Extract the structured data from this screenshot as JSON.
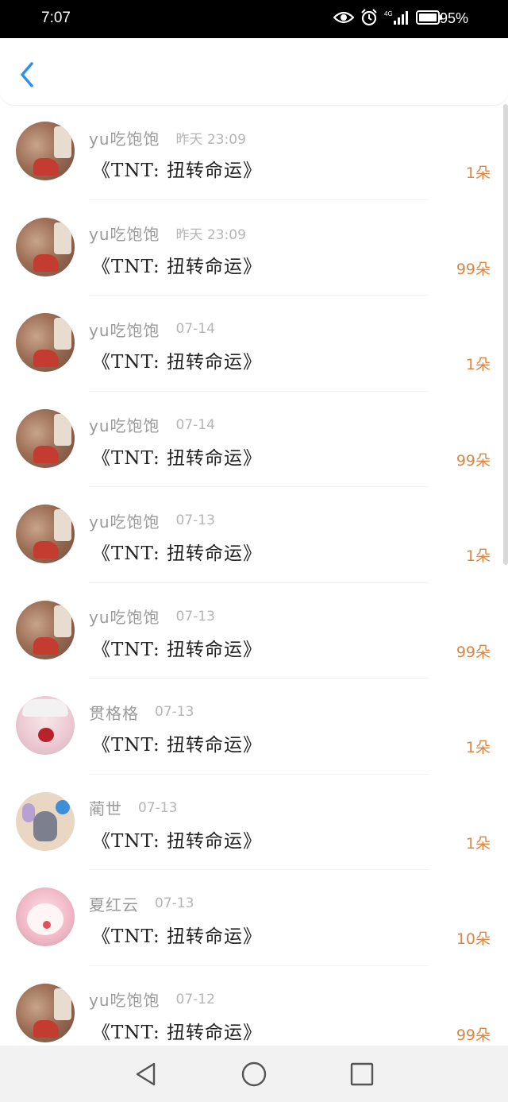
{
  "status_bar": {
    "time": "7:07",
    "battery_percent": "95%",
    "network": "4G",
    "icons": [
      "eye-icon",
      "alarm-icon",
      "signal-icon",
      "battery-icon"
    ]
  },
  "header": {
    "back_icon": "chevron-left-icon"
  },
  "rows": [
    {
      "name": "yu吃饱饱",
      "time": "昨天 23:09",
      "title": "《TNT: 扭转命运》",
      "amount": "1朵",
      "avatar": "a"
    },
    {
      "name": "yu吃饱饱",
      "time": "昨天 23:09",
      "title": "《TNT: 扭转命运》",
      "amount": "99朵",
      "avatar": "a"
    },
    {
      "name": "yu吃饱饱",
      "time": "07-14",
      "title": "《TNT: 扭转命运》",
      "amount": "1朵",
      "avatar": "a"
    },
    {
      "name": "yu吃饱饱",
      "time": "07-14",
      "title": "《TNT: 扭转命运》",
      "amount": "99朵",
      "avatar": "a"
    },
    {
      "name": "yu吃饱饱",
      "time": "07-13",
      "title": "《TNT: 扭转命运》",
      "amount": "1朵",
      "avatar": "a"
    },
    {
      "name": "yu吃饱饱",
      "time": "07-13",
      "title": "《TNT: 扭转命运》",
      "amount": "99朵",
      "avatar": "a"
    },
    {
      "name": "贯格格",
      "time": "07-13",
      "title": "《TNT: 扭转命运》",
      "amount": "1朵",
      "avatar": "b"
    },
    {
      "name": "蔺世",
      "time": "07-13",
      "title": "《TNT: 扭转命运》",
      "amount": "1朵",
      "avatar": "c"
    },
    {
      "name": "夏红云",
      "time": "07-13",
      "title": "《TNT: 扭转命运》",
      "amount": "10朵",
      "avatar": "d"
    },
    {
      "name": "yu吃饱饱",
      "time": "07-12",
      "title": "《TNT: 扭转命运》",
      "amount": "99朵",
      "avatar": "a"
    }
  ],
  "nav_bar": {
    "buttons": [
      "back-triangle-icon",
      "home-circle-icon",
      "recents-square-icon"
    ]
  },
  "colors": {
    "accent": "#e08540",
    "back_arrow": "#2f8ff0",
    "status_bar_bg": "#000000"
  }
}
